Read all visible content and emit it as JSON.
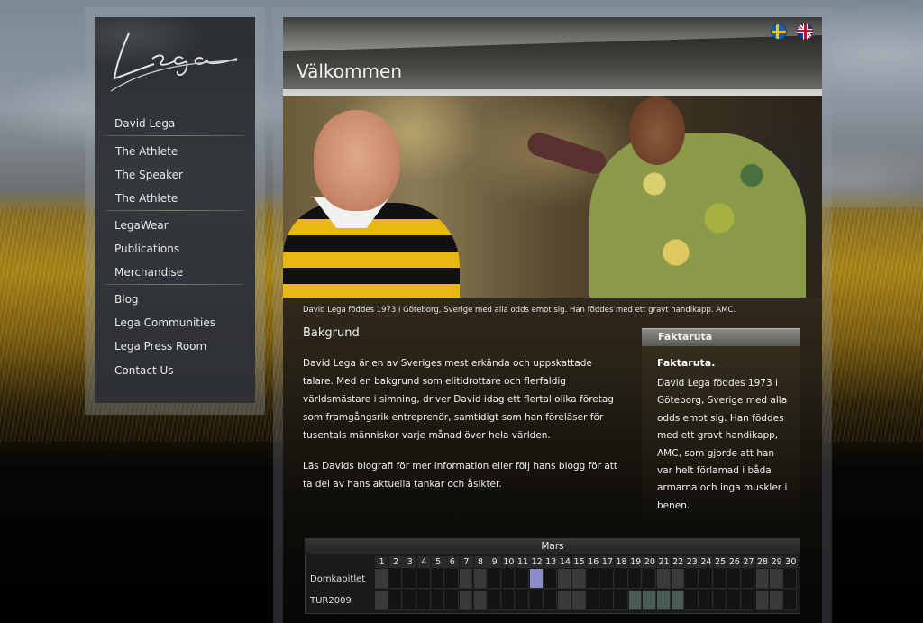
{
  "sidebar": {
    "logo_text": "Lega",
    "items": [
      {
        "label": "David Lega"
      },
      {
        "label": "The Athlete"
      },
      {
        "label": "The Speaker"
      },
      {
        "label": "The Athlete"
      },
      {
        "label": "LegaWear"
      },
      {
        "label": "Publications"
      },
      {
        "label": "Merchandise"
      },
      {
        "label": "Blog"
      },
      {
        "label": "Lega Communities"
      },
      {
        "label": "Lega Press Room"
      },
      {
        "label": "Contact Us"
      }
    ]
  },
  "header": {
    "title": "Välkommen",
    "languages": [
      "Svenska",
      "English"
    ]
  },
  "hero": {
    "caption": "David Lega föddes 1973 i Göteborg, Sverige med alla odds emot sig. Han föddes med ett gravt handikapp. AMC."
  },
  "content": {
    "section_title": "Bakgrund",
    "paragraph1": "David Lega är en av Sveriges mest erkända och uppskattade talare. Med en bakgrund som elitidrottare och flerfaldig världsmästare i simning, driver David idag ett flertal olika företag som framgångsrik entreprenör, samtidigt som han föreläser för tusentals människor varje månad över hela världen.",
    "paragraph2": "Läs Davids biografi för mer information eller följ hans blogg för att ta del av hans aktuella tankar och åsikter."
  },
  "factbox": {
    "header": "Faktaruta",
    "title": "Faktaruta.",
    "text": "David Lega föddes 1973 i Göteborg, Sverige med alla odds emot sig. Han föddes med ett gravt handikapp, AMC, som gjorde att han var helt förlamad i båda armarna och inga muskler i benen."
  },
  "calendar": {
    "month": "Mars",
    "days": [
      "1",
      "2",
      "3",
      "4",
      "5",
      "6",
      "7",
      "8",
      "9",
      "10",
      "11",
      "12",
      "13",
      "14",
      "15",
      "16",
      "17",
      "18",
      "19",
      "20",
      "21",
      "22",
      "23",
      "24",
      "25",
      "26",
      "27",
      "28",
      "29",
      "30"
    ],
    "rows": [
      {
        "label": "Domkapitlet",
        "booked_days": [
          12
        ]
      },
      {
        "label": "TUR2009",
        "booked_days": [
          19,
          20,
          21,
          22
        ]
      }
    ],
    "weekend_days": [
      1,
      7,
      8,
      14,
      15,
      21,
      22,
      28,
      29
    ],
    "colors": {
      "booked": "#8c8cc8",
      "tour": "#4a5a54",
      "weekend": "#3a3a3a"
    }
  }
}
